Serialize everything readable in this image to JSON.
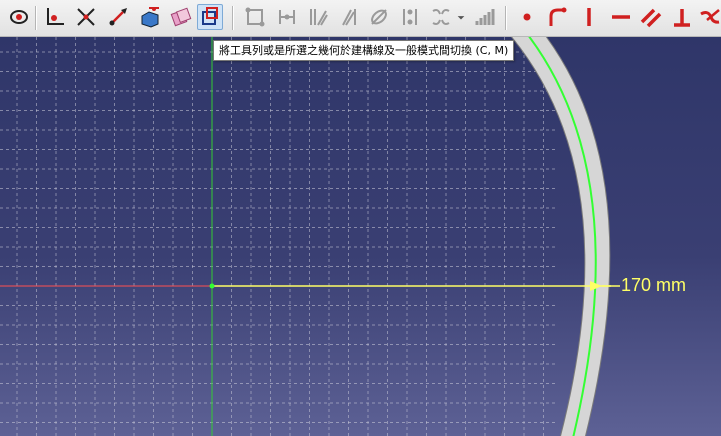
{
  "toolbar": {
    "buttons": [
      {
        "name": "close-shape-icon"
      },
      {
        "name": "add-point-icon"
      },
      {
        "name": "trim-edge-icon"
      },
      {
        "name": "extend-edge-icon"
      },
      {
        "name": "external-geometry-icon"
      },
      {
        "name": "carbon-copy-icon"
      },
      {
        "name": "toggle-construction-geometry-icon",
        "active": true
      },
      {
        "name": "select-constraints-icon"
      },
      {
        "name": "select-origin-icon"
      },
      {
        "name": "select-vertical-axis-icon"
      },
      {
        "name": "select-horizontal-axis-icon"
      },
      {
        "name": "select-redundant-constraints-icon"
      },
      {
        "name": "select-conflicting-constraints-icon"
      },
      {
        "name": "symmetry-icon"
      },
      {
        "name": "rectangular-array-icon"
      },
      {
        "name": "constrain-coincident-icon"
      },
      {
        "name": "constrain-point-on-object-icon"
      },
      {
        "name": "constrain-vertical-icon"
      },
      {
        "name": "constrain-horizontal-icon"
      },
      {
        "name": "constrain-parallel-icon"
      },
      {
        "name": "constrain-perpendicular-icon"
      },
      {
        "name": "constrain-tangent-icon"
      }
    ]
  },
  "tooltip": {
    "text": "將工具列或是所選之幾何於建構線及一般模式間切換 (C, M)"
  },
  "viewport": {
    "dimension_label": "170 mm",
    "colors": {
      "background_top": "#2f3669",
      "background_bottom": "#5d6195",
      "grid": "#c8c8d8",
      "x_axis": "#ff5050",
      "y_axis": "#33cc33",
      "geometry": "#33ff33",
      "dimension": "#ffff66",
      "solid_face": "#d6d6d6"
    }
  }
}
